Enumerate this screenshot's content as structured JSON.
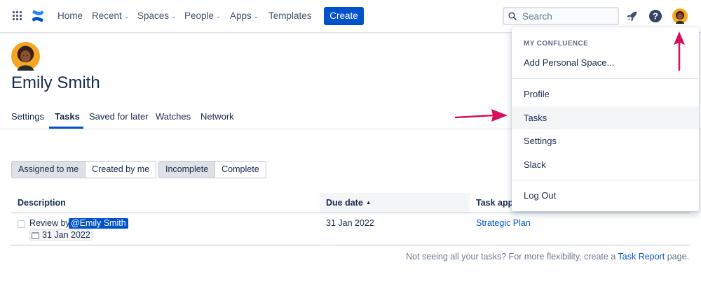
{
  "topnav": {
    "items": [
      {
        "label": "Home",
        "dropdown": false
      },
      {
        "label": "Recent",
        "dropdown": true
      },
      {
        "label": "Spaces",
        "dropdown": true
      },
      {
        "label": "People",
        "dropdown": true
      },
      {
        "label": "Apps",
        "dropdown": true
      },
      {
        "label": "Templates",
        "dropdown": false
      }
    ],
    "create_label": "Create",
    "search_placeholder": "Search",
    "icons": [
      "app-switcher-icon",
      "confluence-logo-icon",
      "notifications-rocket-icon",
      "help-icon",
      "profile-avatar-icon"
    ]
  },
  "profile": {
    "name": "Emily Smith",
    "tabs": [
      {
        "label": "Settings",
        "active": false
      },
      {
        "label": "Tasks",
        "active": true
      },
      {
        "label": "Saved for later",
        "active": false
      },
      {
        "label": "Watches",
        "active": false
      },
      {
        "label": "Network",
        "active": false
      }
    ]
  },
  "filters": {
    "assignee": {
      "options": [
        "Assigned to me",
        "Created by me"
      ],
      "selected": "Assigned to me"
    },
    "status": {
      "options": [
        "Incomplete",
        "Complete"
      ],
      "selected": "Incomplete"
    }
  },
  "table": {
    "columns": {
      "description": "Description",
      "due_date": "Due date",
      "task_app": "Task app"
    },
    "sorted_by": "Due date",
    "sort_direction": "ascending",
    "rows": [
      {
        "description_prefix": "Review by",
        "mention": "@Emily Smith",
        "inline_date": "31 Jan 2022",
        "due_date": "31 Jan 2022",
        "page": "Strategic Plan"
      }
    ]
  },
  "footer": {
    "prefix": "Not seeing all your tasks? For more flexibility, create a",
    "link": "Task Report",
    "suffix": "page."
  },
  "dropdown": {
    "heading": "MY CONFLUENCE",
    "add_space": "Add Personal Space...",
    "items": [
      "Profile",
      "Tasks",
      "Settings",
      "Slack"
    ],
    "highlighted": "Tasks",
    "logout": "Log Out"
  },
  "colors": {
    "brand_blue": "#0052cc",
    "annotation_arrow": "#d6105b",
    "avatar_ring": "#f5a623"
  }
}
